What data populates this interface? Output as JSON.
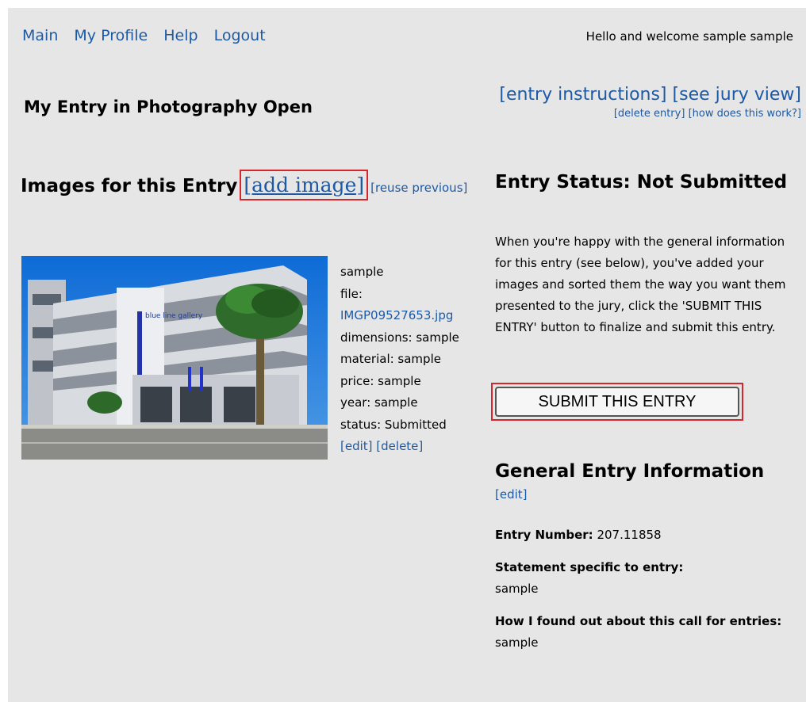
{
  "nav": {
    "items": [
      "Main",
      "My Profile",
      "Help",
      "Logout"
    ],
    "welcome": "Hello and welcome sample sample"
  },
  "page": {
    "title": "My Entry in Photography Open",
    "links": {
      "entry_instructions": "[entry instructions]",
      "see_jury_view": "[see jury view]",
      "delete_entry": "[delete entry]",
      "how_does_this_work": "[how does this work?]"
    }
  },
  "images": {
    "heading": "Images for this Entry",
    "add_image": "[add image]",
    "reuse_previous": "[reuse previous]",
    "items": [
      {
        "title": "sample",
        "file_label": "file:",
        "file_name": "IMGP09527653.jpg",
        "dimensions": "dimensions: sample",
        "material": "material: sample",
        "price": "price: sample",
        "year": "year: sample",
        "status": "status: Submitted",
        "edit": "[edit]",
        "delete": "[delete]"
      }
    ]
  },
  "status": {
    "heading": "Entry Status: Not Submitted",
    "instructions": "When you're happy with the general information for this entry (see below), you've added your images and sorted them the way you want them presented to the jury, click the 'SUBMIT THIS ENTRY' button to finalize and submit this entry.",
    "submit_label": "SUBMIT THIS ENTRY"
  },
  "general": {
    "heading": "General Entry Information",
    "edit": "[edit]",
    "entry_number_label": "Entry Number:",
    "entry_number": "207.11858",
    "statement_label": "Statement specific to entry:",
    "statement_value": "sample",
    "found_label": "How I found out about this call for entries:",
    "found_value": "sample"
  },
  "colors": {
    "link": "#1d5aa6",
    "background": "#e6e6e6",
    "highlight_box": "#d6262c"
  }
}
